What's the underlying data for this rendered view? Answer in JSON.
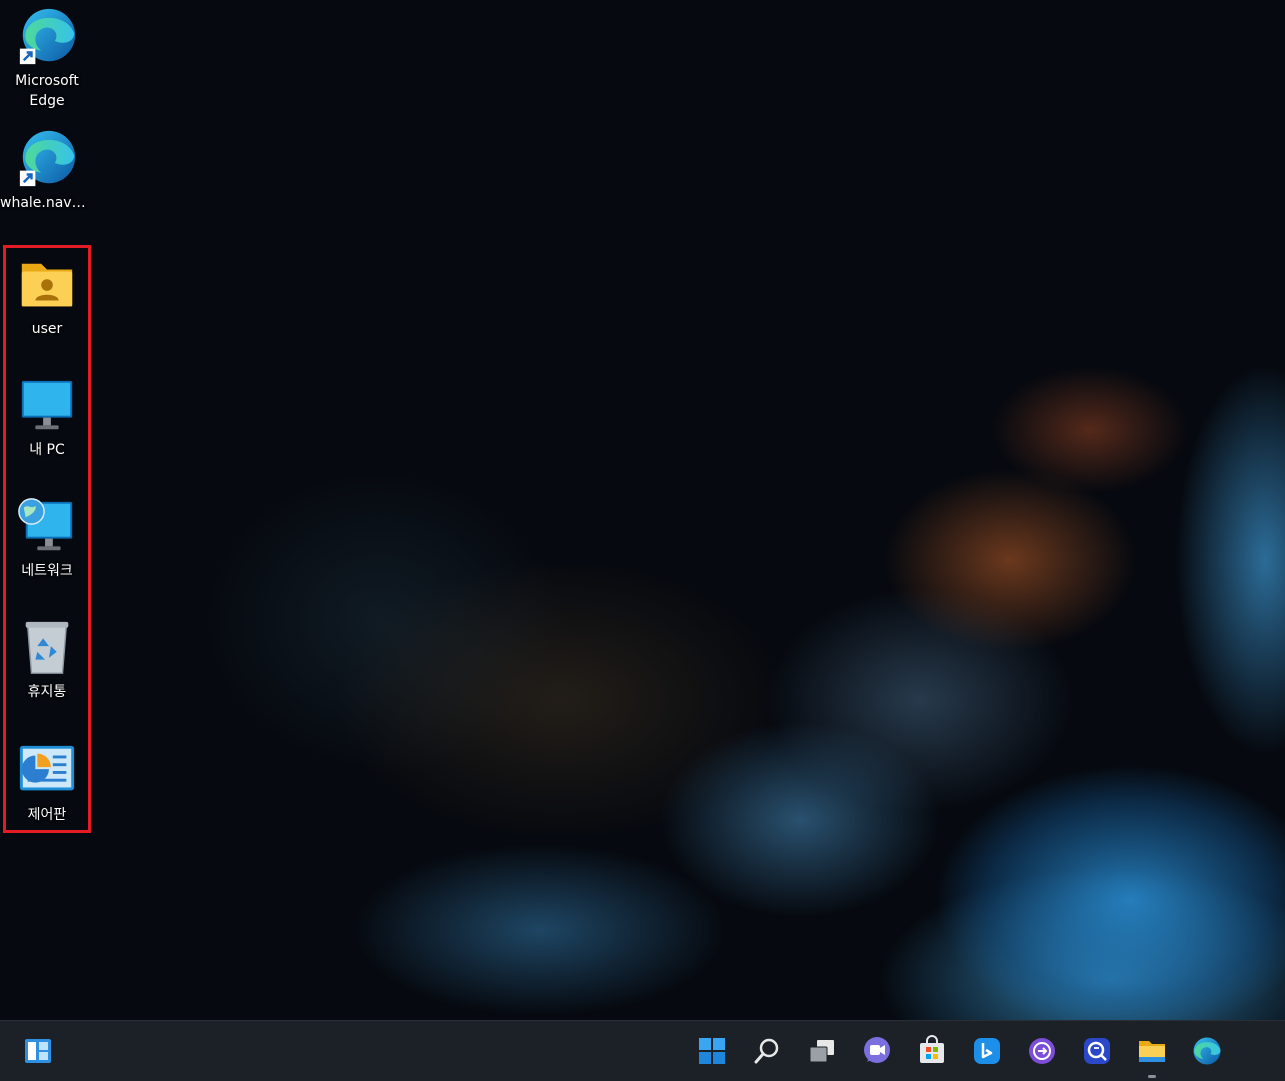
{
  "desktop": {
    "icons": [
      {
        "name": "microsoft-edge-shortcut",
        "label": "Microsoft Edge"
      },
      {
        "name": "whale-naver-shortcut",
        "label": "whale.naver..."
      },
      {
        "name": "user-folder",
        "label": "user"
      },
      {
        "name": "this-pc",
        "label": "내 PC"
      },
      {
        "name": "network",
        "label": "네트워크"
      },
      {
        "name": "recycle-bin",
        "label": "휴지통"
      },
      {
        "name": "control-panel",
        "label": "제어판"
      }
    ],
    "selection_color": "#e21b24"
  },
  "taskbar": {
    "widgets": "widgets-icon",
    "items": [
      "start-icon",
      "search-icon",
      "task-view-icon",
      "chat-icon",
      "store-icon",
      "bing-icon",
      "app-icon",
      "search-app-icon",
      "file-explorer-icon",
      "edge-icon"
    ],
    "background": "#1c2027"
  }
}
